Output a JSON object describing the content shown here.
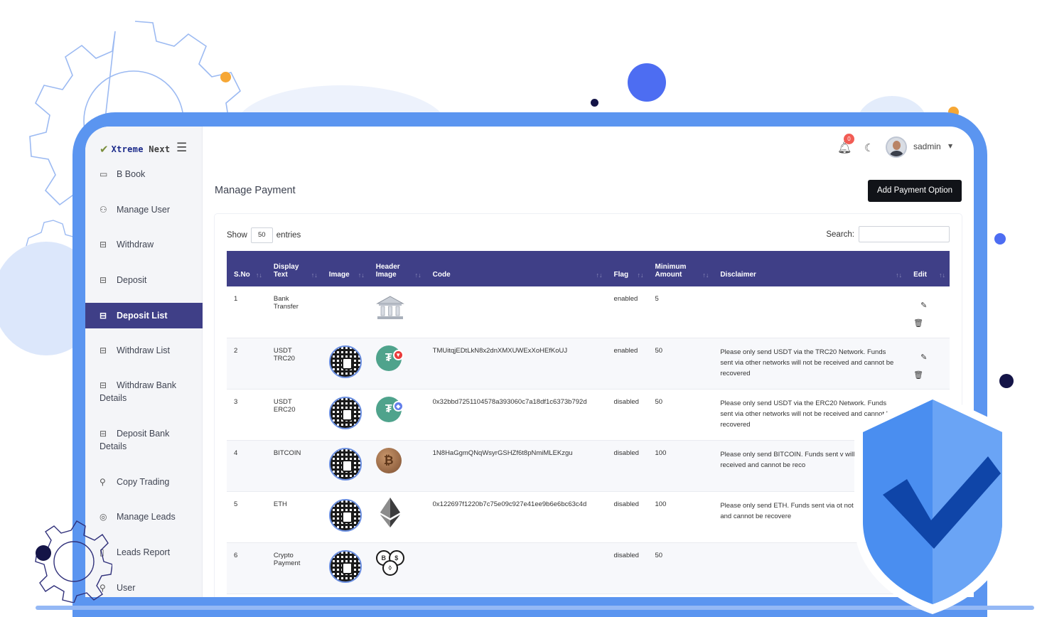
{
  "brand": {
    "name_part1": "Xtreme",
    "name_part2": "Next"
  },
  "topbar": {
    "notifications_count": "0",
    "username": "sadmin"
  },
  "sidebar": {
    "items": [
      {
        "label": "B Book",
        "icon": "book-icon"
      },
      {
        "label": "Manage User",
        "icon": "users-icon"
      },
      {
        "label": "Withdraw",
        "icon": "archive-icon"
      },
      {
        "label": "Deposit",
        "icon": "archive-icon"
      },
      {
        "label": "Deposit List",
        "icon": "archive-icon",
        "active": true
      },
      {
        "label": "Withdraw List",
        "icon": "archive-icon"
      },
      {
        "label": "Withdraw Bank Details",
        "icon": "archive-icon"
      },
      {
        "label": "Deposit Bank Details",
        "icon": "archive-icon"
      },
      {
        "label": "Copy Trading",
        "icon": "user-plus-icon"
      },
      {
        "label": "Manage Leads",
        "icon": "check-circle-icon"
      },
      {
        "label": "Leads Report",
        "icon": "file-icon"
      },
      {
        "label": "User",
        "icon": "user-icon"
      }
    ]
  },
  "page": {
    "title": "Manage Payment",
    "add_button": "Add Payment Option",
    "show_label": "Show",
    "entries_value": "50",
    "entries_label": "entries",
    "search_label": "Search:"
  },
  "table": {
    "columns": [
      "S.No",
      "Display Text",
      "Image",
      "Header Image",
      "Code",
      "Flag",
      "Minimum Amount",
      "Disclaimer",
      "Edit"
    ],
    "rows": [
      {
        "sno": "1",
        "display": "Bank Transfer",
        "image": "",
        "header_image": "bank-icon",
        "code": "",
        "flag": "enabled",
        "min": "5",
        "disclaimer": ""
      },
      {
        "sno": "2",
        "display": "USDT TRC20",
        "image": "qr-code",
        "header_image": "usdt-trc20-icon",
        "code": "TMUitqjEDtLkN8x2dnXMXUWExXoHEfKoUJ",
        "flag": "enabled",
        "min": "50",
        "disclaimer": "Please only send USDT via the TRC20 Network. Funds sent via other networks will not be received and cannot be recovered"
      },
      {
        "sno": "3",
        "display": "USDT ERC20",
        "image": "qr-code",
        "header_image": "usdt-erc20-icon",
        "code": "0x32bbd7251104578a393060c7a18df1c6373b792d",
        "flag": "disabled",
        "min": "50",
        "disclaimer": "Please only send USDT via the ERC20 Network. Funds sent via other networks will not be received and cannot be recovered"
      },
      {
        "sno": "4",
        "display": "BITCOIN",
        "image": "qr-code",
        "header_image": "bitcoin-icon",
        "code": "1N8HaGgmQNqWsyrGSHZf6t8pNmiMLEKzgu",
        "flag": "disabled",
        "min": "100",
        "disclaimer": "Please only send BITCOIN. Funds sent v will not be received and cannot be reco"
      },
      {
        "sno": "5",
        "display": "ETH",
        "image": "qr-code",
        "header_image": "ethereum-icon",
        "code": "0x122697f1220b7c75e09c927e41ee9b6e6bc63c4d",
        "flag": "disabled",
        "min": "100",
        "disclaimer": "Please only send ETH. Funds sent via ot not be received and cannot be recovere"
      },
      {
        "sno": "6",
        "display": "Crypto Payment",
        "image": "qr-code",
        "header_image": "crypto-coins-icon",
        "code": "",
        "flag": "disabled",
        "min": "50",
        "disclaimer": ""
      }
    ]
  },
  "colors": {
    "sidebar_active": "#3f3f87",
    "table_header": "#3f3f87",
    "enabled": "#1c8a24",
    "disabled": "#e0302f",
    "frame": "#5b95f0"
  }
}
